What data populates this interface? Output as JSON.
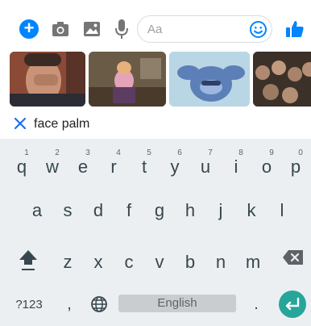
{
  "composer": {
    "input_placeholder": "Aa",
    "plus_icon": "plus-circle-icon",
    "camera_icon": "camera-icon",
    "gallery_icon": "image-icon",
    "mic_icon": "microphone-icon",
    "emoji_icon": "smiley-icon",
    "like_icon": "thumbs-up-icon",
    "accent": "#0084ff"
  },
  "gifs": [
    "gif-result-1",
    "gif-result-2",
    "gif-result-3",
    "gif-result-4"
  ],
  "search": {
    "close_icon": "close-icon",
    "query": "face palm"
  },
  "keyboard": {
    "row1": [
      {
        "ch": "q",
        "hint": "1"
      },
      {
        "ch": "w",
        "hint": "2"
      },
      {
        "ch": "e",
        "hint": "3"
      },
      {
        "ch": "r",
        "hint": "4"
      },
      {
        "ch": "t",
        "hint": "5"
      },
      {
        "ch": "y",
        "hint": "6"
      },
      {
        "ch": "u",
        "hint": "7"
      },
      {
        "ch": "i",
        "hint": "8"
      },
      {
        "ch": "o",
        "hint": "9"
      },
      {
        "ch": "p",
        "hint": "0"
      }
    ],
    "row2": [
      "a",
      "s",
      "d",
      "f",
      "g",
      "h",
      "j",
      "k",
      "l"
    ],
    "row3": [
      "z",
      "x",
      "c",
      "v",
      "b",
      "n",
      "m"
    ],
    "symbols_label": "?123",
    "comma": ",",
    "space_label": "English",
    "period": ".",
    "enter_color": "#26a69a"
  }
}
